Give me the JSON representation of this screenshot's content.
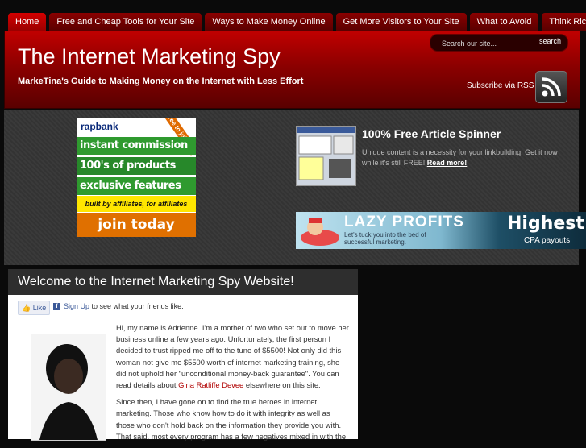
{
  "nav": [
    {
      "label": "Home"
    },
    {
      "label": "Free and Cheap Tools for Your Site"
    },
    {
      "label": "Ways to Make Money Online"
    },
    {
      "label": "Get More Visitors to Your Site"
    },
    {
      "label": "What to Avoid"
    },
    {
      "label": "Think Rich"
    }
  ],
  "header": {
    "title": "The Internet Marketing Spy",
    "tagline": "MarkeTina's Guide to Making Money on the Internet with Less Effort",
    "search_placeholder": "Search our site...",
    "search_button": "search",
    "subscribe_text": "Subscribe via",
    "subscribe_link": "RSS"
  },
  "ads": {
    "rapbank": {
      "logo": "rapbank",
      "corner": "free to join",
      "lines": [
        "instant commission",
        "100's of products",
        "exclusive features"
      ],
      "built": "built by affiliates, for affiliates",
      "cta": "join today"
    },
    "spinner": {
      "title": "100% Free Article Spinner",
      "desc": "Unique content is a necessity for your linkbuilding. Get it now while it's still FREE!",
      "link": "Read more!"
    },
    "lazy": {
      "title": "LAZY PROFITS",
      "sub": "Let's tuck you into the bed of successful marketing.",
      "highest": "Highest",
      "cpa": "CPA payouts!"
    }
  },
  "content": {
    "heading": "Welcome to the Internet Marketing Spy Website!",
    "like": "Like",
    "signup_link": "Sign Up",
    "signup_rest": "to see what your friends like.",
    "p1_a": "Hi, my name is Adrienne. I'm a mother of two who set out to move her business online a few years ago. Unfortunately, the first person I decided to trust ripped me off to the tune of $5500! Not only did this woman not give me $5500 worth of internet marketing training, she did not uphold her \"unconditional money-back guarantee\". You can read details about",
    "p1_link": "Gina Ratliffe Devee",
    "p1_b": "elsewhere on this site.",
    "p2": "Since then, I have gone on to find the true heroes in internet marketing. Those who know how to do it with integrity as well as those who don't hold back on the information they provide you with. That said, most every program has a few negatives mixed in with the"
  },
  "colors": {
    "accent": "#b00000",
    "nav_active": "#d40000",
    "link": "#3b5998"
  }
}
